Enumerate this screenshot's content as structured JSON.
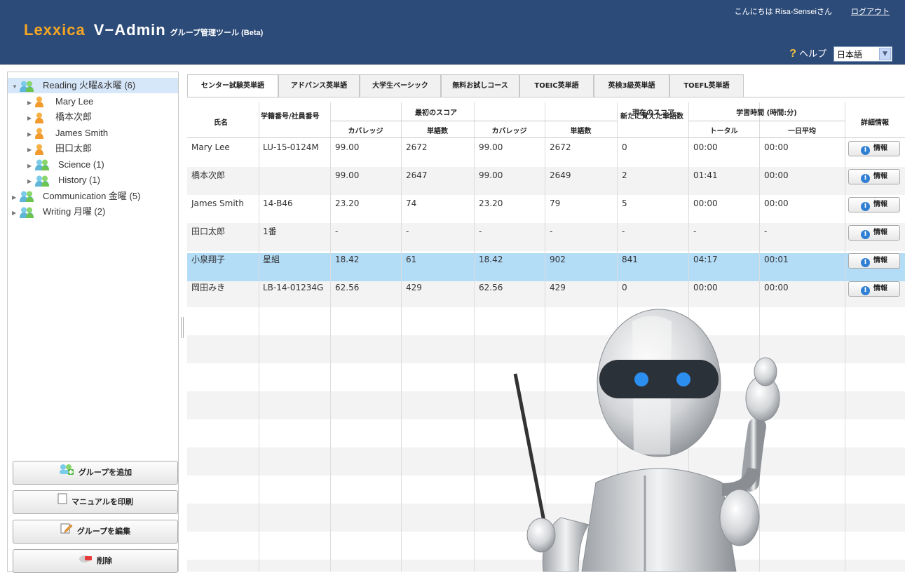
{
  "header": {
    "brand": "Lexxica",
    "product": "V−Admin",
    "tool": "グループ管理ツール (Beta)",
    "greeting": "こんにちは Risa-Senseiさん",
    "logout": "ログアウト",
    "help": "ヘルプ",
    "help_icon": "?",
    "language": "日本語"
  },
  "sidebar": {
    "tree": [
      {
        "label": "Reading 火曜&水曜 (6)",
        "type": "group",
        "level": 0,
        "expanded": true,
        "selected": true
      },
      {
        "label": "Mary Lee",
        "type": "user",
        "level": 1
      },
      {
        "label": "橋本次郎",
        "type": "user",
        "level": 1
      },
      {
        "label": "James Smith",
        "type": "user",
        "level": 1
      },
      {
        "label": "田口太郎",
        "type": "user",
        "level": 1
      },
      {
        "label": "Science (1)",
        "type": "group",
        "level": 1
      },
      {
        "label": "History (1)",
        "type": "group",
        "level": 1
      },
      {
        "label": "Communication 金曜 (5)",
        "type": "group",
        "level": 0
      },
      {
        "label": "Writing 月曜 (2)",
        "type": "group",
        "level": 0
      }
    ],
    "buttons": {
      "add_group": "グループを追加",
      "print_manual": "マニュアルを印刷",
      "edit_group": "グループを編集",
      "delete": "削除"
    }
  },
  "tabs": [
    "センター試験英単語",
    "アドバンス英単語",
    "大学生ベーシック",
    "無料お試しコース",
    "TOEIC英単語",
    "英検3級英単語",
    "TOEFL英単語"
  ],
  "active_tab": 0,
  "table": {
    "headers": {
      "name": "氏名",
      "id": "学籍番号/社員番号",
      "initial": "最初のスコア",
      "current": "現在のスコア",
      "coverage": "カバレッジ",
      "words": "単語数",
      "new_words": "新たに覚えた単語数",
      "study_time": "学習時間 (時間:分)",
      "total": "トータル",
      "daily": "一日平均",
      "details": "詳細情報"
    },
    "info_label": "情報",
    "rows": [
      {
        "name": "Mary Lee",
        "id": "LU-15-0124M",
        "init_cov": "99.00",
        "init_words": "2672",
        "cur_cov": "99.00",
        "cur_words": "2672",
        "new": "0",
        "total": "00:00",
        "daily": "00:00"
      },
      {
        "name": "橋本次郎",
        "id": "",
        "init_cov": "99.00",
        "init_words": "2647",
        "cur_cov": "99.00",
        "cur_words": "2649",
        "new": "2",
        "total": "01:41",
        "daily": "00:00"
      },
      {
        "name": "James Smith",
        "id": "14-B46",
        "init_cov": "23.20",
        "init_words": "74",
        "cur_cov": "23.20",
        "cur_words": "79",
        "new": "5",
        "total": "00:00",
        "daily": "00:00"
      },
      {
        "name": "田口太郎",
        "id": "1番",
        "init_cov": "-",
        "init_words": "-",
        "cur_cov": "-",
        "cur_words": "-",
        "new": "-",
        "total": "-",
        "daily": "-"
      },
      {
        "name": "小泉翔子",
        "id": "星組",
        "init_cov": "18.42",
        "init_words": "61",
        "cur_cov": "18.42",
        "cur_words": "902",
        "new": "841",
        "total": "04:17",
        "daily": "00:01",
        "selected": true
      },
      {
        "name": "岡田みき",
        "id": "LB-14-01234G",
        "init_cov": "62.56",
        "init_words": "429",
        "cur_cov": "62.56",
        "cur_words": "429",
        "new": "0",
        "total": "00:00",
        "daily": "00:00"
      }
    ]
  },
  "colors": {
    "header_bg": "#2d4b79",
    "brand": "#f6a623",
    "selected_row": "#b3dcf7",
    "selected_tree": "#d7e7fa"
  }
}
